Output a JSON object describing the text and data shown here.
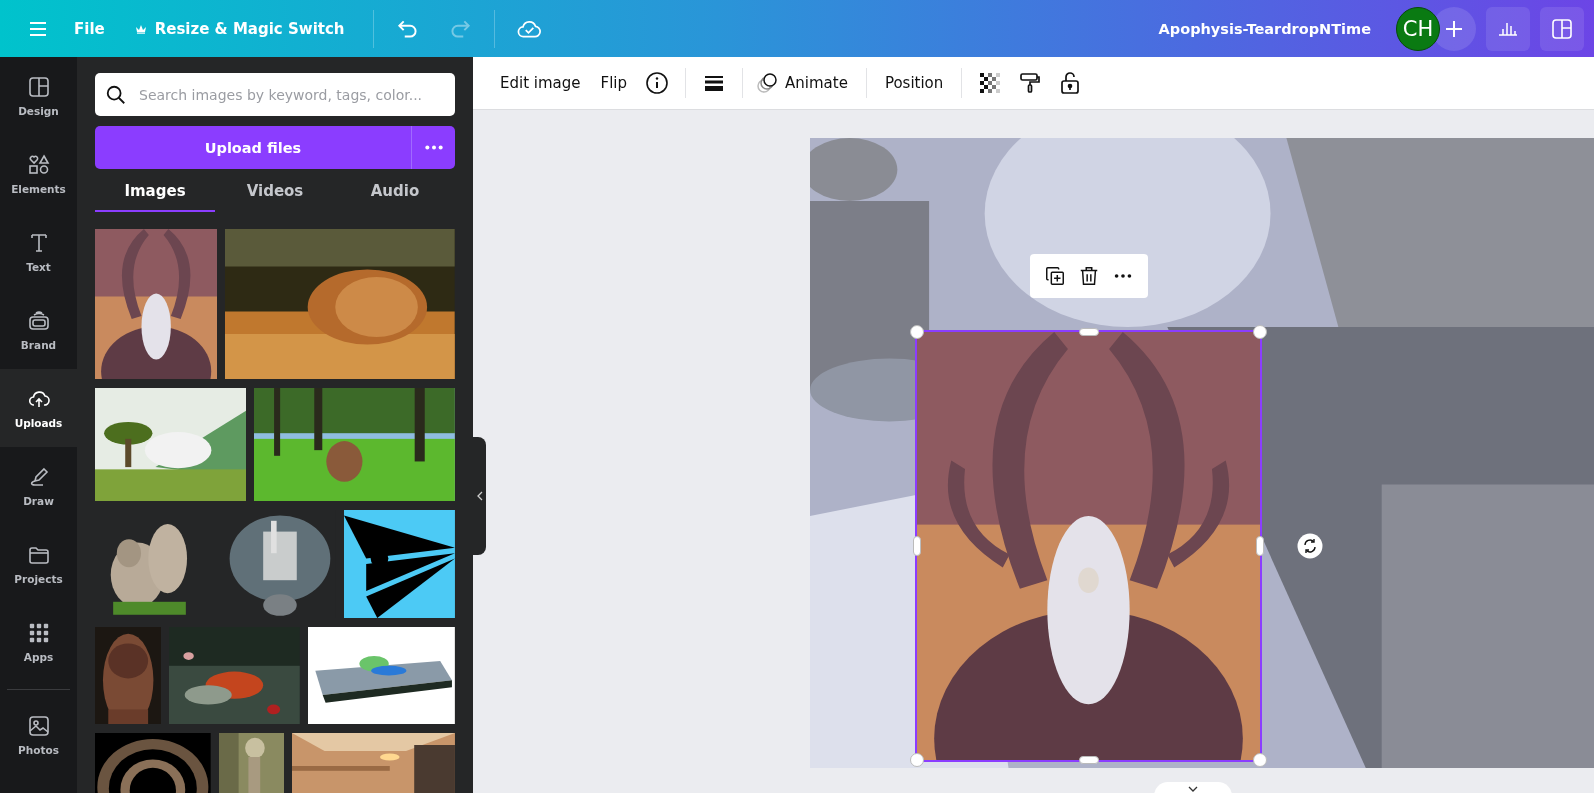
{
  "top_bar": {
    "file_menu": "File",
    "resize_button": "Resize & Magic Switch",
    "undo": {
      "disabled": false
    },
    "redo": {
      "disabled": true
    },
    "design_title": "Apophysis-TeardropNTime",
    "avatar_initials": "CH"
  },
  "rail": [
    {
      "label": "Design",
      "selected": false
    },
    {
      "label": "Elements",
      "selected": false
    },
    {
      "label": "Text",
      "selected": false
    },
    {
      "label": "Brand",
      "selected": false
    },
    {
      "label": "Uploads",
      "selected": true
    },
    {
      "label": "Draw",
      "selected": false
    },
    {
      "label": "Projects",
      "selected": false
    },
    {
      "label": "Apps",
      "selected": false
    },
    {
      "label": "Photos",
      "selected": false
    }
  ],
  "panel": {
    "search": {
      "placeholder": "Search images by keyword, tags, color..."
    },
    "upload_button": "Upload files",
    "tabs": [
      {
        "label": "Images",
        "selected": true
      },
      {
        "label": "Videos",
        "selected": false
      },
      {
        "label": "Audio",
        "selected": false
      }
    ]
  },
  "toolbar": [
    {
      "kind": "text",
      "label": "Edit image"
    },
    {
      "kind": "text",
      "label": "Flip"
    },
    {
      "kind": "info"
    },
    {
      "kind": "divider"
    },
    {
      "kind": "border"
    },
    {
      "kind": "divider"
    },
    {
      "kind": "animate",
      "label": "Animate"
    },
    {
      "kind": "divider"
    },
    {
      "kind": "text",
      "label": "Position"
    },
    {
      "kind": "divider"
    },
    {
      "kind": "transparency"
    },
    {
      "kind": "paint"
    },
    {
      "kind": "lock"
    }
  ]
}
